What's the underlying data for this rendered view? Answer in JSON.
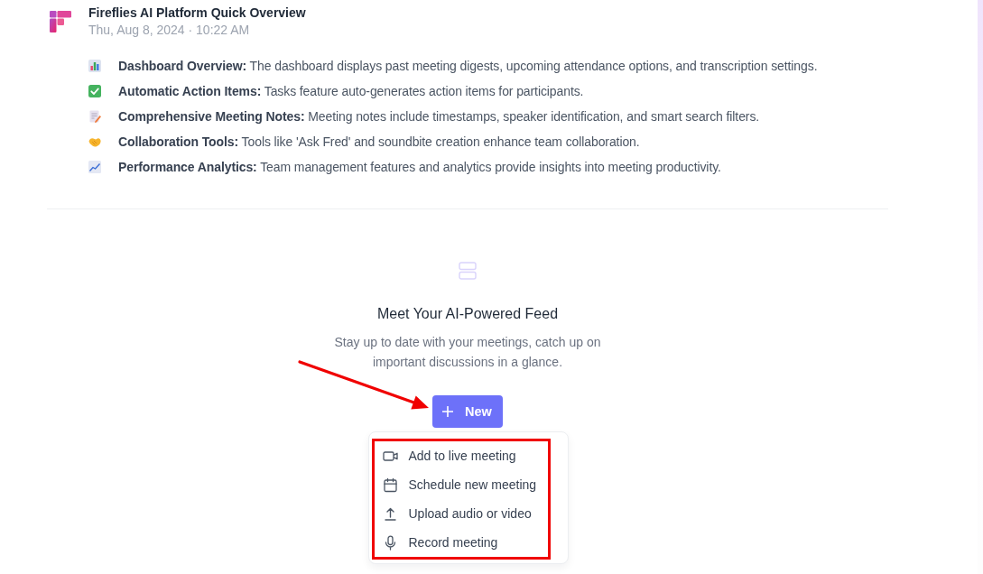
{
  "meeting": {
    "title": "Fireflies AI Platform Quick Overview",
    "date": "Thu, Aug 8, 2024 · 10:22 AM"
  },
  "summary": [
    {
      "kind": "chart",
      "text": "**Dashboard Overview:** The dashboard displays past meeting digests, upcoming attendance options, and transcription settings."
    },
    {
      "kind": "check",
      "text": "**Automatic Action Items:** Tasks feature auto-generates action items for participants."
    },
    {
      "kind": "note",
      "text": "**Comprehensive Meeting Notes:** Meeting notes include timestamps, speaker identification, and smart search filters."
    },
    {
      "kind": "handshake",
      "text": "**Collaboration Tools:** Tools like 'Ask Fred' and soundbite creation enhance team collaboration."
    },
    {
      "kind": "trend",
      "text": "**Performance Analytics:** Team management features and analytics provide insights into meeting productivity."
    }
  ],
  "feed": {
    "heading": "Meet Your AI-Powered Feed",
    "description": "Stay up to date with your meetings, catch up on important discussions in a glance.",
    "new_button": {
      "label": "New"
    },
    "menu": [
      {
        "kind": "video",
        "label": "Add to live meeting"
      },
      {
        "kind": "calendar",
        "label": "Schedule new meeting"
      },
      {
        "kind": "upload",
        "label": "Upload audio or video"
      },
      {
        "kind": "microphone",
        "label": "Record meeting"
      }
    ]
  },
  "annotations": {
    "arrow": true,
    "menu_frame": true
  }
}
